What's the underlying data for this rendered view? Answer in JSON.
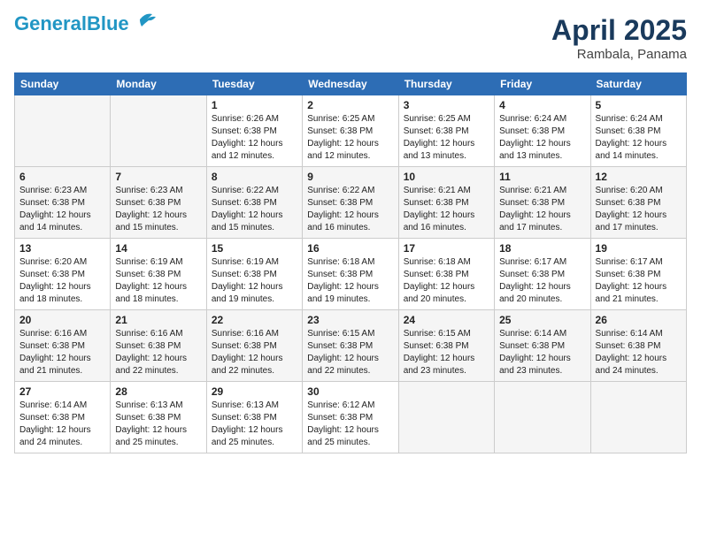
{
  "header": {
    "logo_line1": "General",
    "logo_line2": "Blue",
    "month": "April 2025",
    "location": "Rambala, Panama"
  },
  "days_of_week": [
    "Sunday",
    "Monday",
    "Tuesday",
    "Wednesday",
    "Thursday",
    "Friday",
    "Saturday"
  ],
  "weeks": [
    [
      {
        "day": "",
        "info": ""
      },
      {
        "day": "",
        "info": ""
      },
      {
        "day": "1",
        "info": "Sunrise: 6:26 AM\nSunset: 6:38 PM\nDaylight: 12 hours\nand 12 minutes."
      },
      {
        "day": "2",
        "info": "Sunrise: 6:25 AM\nSunset: 6:38 PM\nDaylight: 12 hours\nand 12 minutes."
      },
      {
        "day": "3",
        "info": "Sunrise: 6:25 AM\nSunset: 6:38 PM\nDaylight: 12 hours\nand 13 minutes."
      },
      {
        "day": "4",
        "info": "Sunrise: 6:24 AM\nSunset: 6:38 PM\nDaylight: 12 hours\nand 13 minutes."
      },
      {
        "day": "5",
        "info": "Sunrise: 6:24 AM\nSunset: 6:38 PM\nDaylight: 12 hours\nand 14 minutes."
      }
    ],
    [
      {
        "day": "6",
        "info": "Sunrise: 6:23 AM\nSunset: 6:38 PM\nDaylight: 12 hours\nand 14 minutes."
      },
      {
        "day": "7",
        "info": "Sunrise: 6:23 AM\nSunset: 6:38 PM\nDaylight: 12 hours\nand 15 minutes."
      },
      {
        "day": "8",
        "info": "Sunrise: 6:22 AM\nSunset: 6:38 PM\nDaylight: 12 hours\nand 15 minutes."
      },
      {
        "day": "9",
        "info": "Sunrise: 6:22 AM\nSunset: 6:38 PM\nDaylight: 12 hours\nand 16 minutes."
      },
      {
        "day": "10",
        "info": "Sunrise: 6:21 AM\nSunset: 6:38 PM\nDaylight: 12 hours\nand 16 minutes."
      },
      {
        "day": "11",
        "info": "Sunrise: 6:21 AM\nSunset: 6:38 PM\nDaylight: 12 hours\nand 17 minutes."
      },
      {
        "day": "12",
        "info": "Sunrise: 6:20 AM\nSunset: 6:38 PM\nDaylight: 12 hours\nand 17 minutes."
      }
    ],
    [
      {
        "day": "13",
        "info": "Sunrise: 6:20 AM\nSunset: 6:38 PM\nDaylight: 12 hours\nand 18 minutes."
      },
      {
        "day": "14",
        "info": "Sunrise: 6:19 AM\nSunset: 6:38 PM\nDaylight: 12 hours\nand 18 minutes."
      },
      {
        "day": "15",
        "info": "Sunrise: 6:19 AM\nSunset: 6:38 PM\nDaylight: 12 hours\nand 19 minutes."
      },
      {
        "day": "16",
        "info": "Sunrise: 6:18 AM\nSunset: 6:38 PM\nDaylight: 12 hours\nand 19 minutes."
      },
      {
        "day": "17",
        "info": "Sunrise: 6:18 AM\nSunset: 6:38 PM\nDaylight: 12 hours\nand 20 minutes."
      },
      {
        "day": "18",
        "info": "Sunrise: 6:17 AM\nSunset: 6:38 PM\nDaylight: 12 hours\nand 20 minutes."
      },
      {
        "day": "19",
        "info": "Sunrise: 6:17 AM\nSunset: 6:38 PM\nDaylight: 12 hours\nand 21 minutes."
      }
    ],
    [
      {
        "day": "20",
        "info": "Sunrise: 6:16 AM\nSunset: 6:38 PM\nDaylight: 12 hours\nand 21 minutes."
      },
      {
        "day": "21",
        "info": "Sunrise: 6:16 AM\nSunset: 6:38 PM\nDaylight: 12 hours\nand 22 minutes."
      },
      {
        "day": "22",
        "info": "Sunrise: 6:16 AM\nSunset: 6:38 PM\nDaylight: 12 hours\nand 22 minutes."
      },
      {
        "day": "23",
        "info": "Sunrise: 6:15 AM\nSunset: 6:38 PM\nDaylight: 12 hours\nand 22 minutes."
      },
      {
        "day": "24",
        "info": "Sunrise: 6:15 AM\nSunset: 6:38 PM\nDaylight: 12 hours\nand 23 minutes."
      },
      {
        "day": "25",
        "info": "Sunrise: 6:14 AM\nSunset: 6:38 PM\nDaylight: 12 hours\nand 23 minutes."
      },
      {
        "day": "26",
        "info": "Sunrise: 6:14 AM\nSunset: 6:38 PM\nDaylight: 12 hours\nand 24 minutes."
      }
    ],
    [
      {
        "day": "27",
        "info": "Sunrise: 6:14 AM\nSunset: 6:38 PM\nDaylight: 12 hours\nand 24 minutes."
      },
      {
        "day": "28",
        "info": "Sunrise: 6:13 AM\nSunset: 6:38 PM\nDaylight: 12 hours\nand 25 minutes."
      },
      {
        "day": "29",
        "info": "Sunrise: 6:13 AM\nSunset: 6:38 PM\nDaylight: 12 hours\nand 25 minutes."
      },
      {
        "day": "30",
        "info": "Sunrise: 6:12 AM\nSunset: 6:38 PM\nDaylight: 12 hours\nand 25 minutes."
      },
      {
        "day": "",
        "info": ""
      },
      {
        "day": "",
        "info": ""
      },
      {
        "day": "",
        "info": ""
      }
    ]
  ]
}
